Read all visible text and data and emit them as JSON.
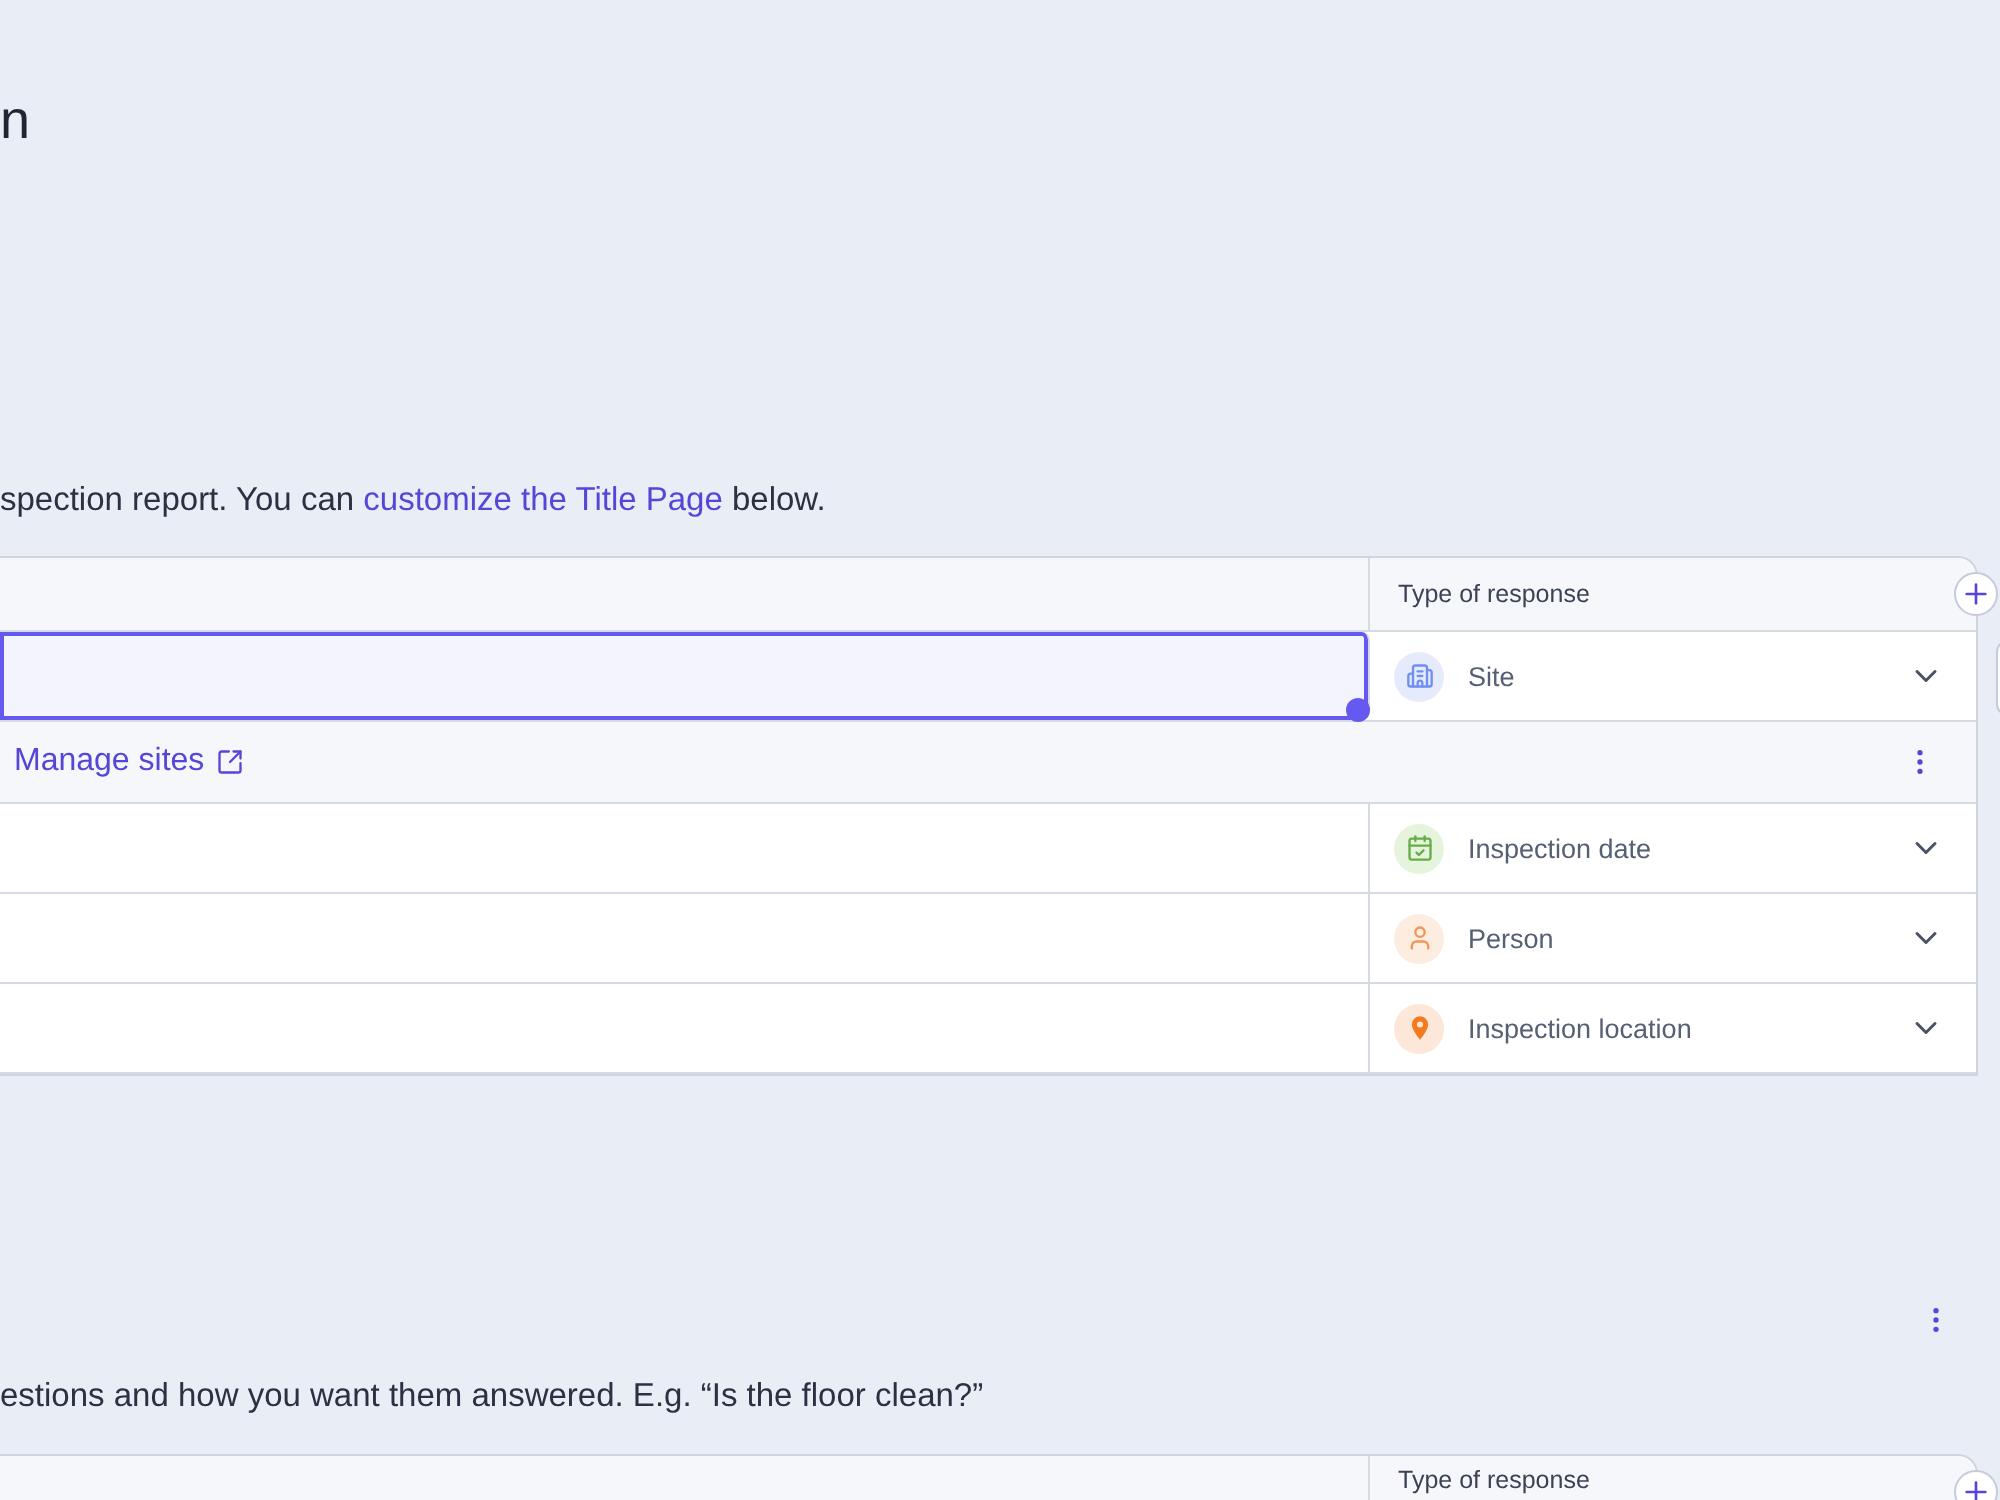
{
  "header": {
    "title": "n"
  },
  "title_page": {
    "intro": {
      "text": "spection report. You can ",
      "link": "customize the Title Page",
      "text_after": " below."
    },
    "column_header": "Type of response",
    "rows": [
      {
        "kind": "question",
        "selected": true,
        "response": {
          "kind": "site",
          "label": "Site"
        }
      },
      {
        "kind": "options",
        "link": "Manage sites"
      },
      {
        "kind": "question",
        "selected": false,
        "response": {
          "kind": "date",
          "label": "Inspection date"
        }
      },
      {
        "kind": "question",
        "selected": false,
        "response": {
          "kind": "person",
          "label": "Person"
        }
      },
      {
        "kind": "question",
        "selected": false,
        "response": {
          "kind": "location",
          "label": "Inspection location"
        }
      }
    ]
  },
  "section": {
    "intro": "estions and how you want them answered. E.g. “Is the floor clean?”",
    "column_header": "Type of response"
  }
}
